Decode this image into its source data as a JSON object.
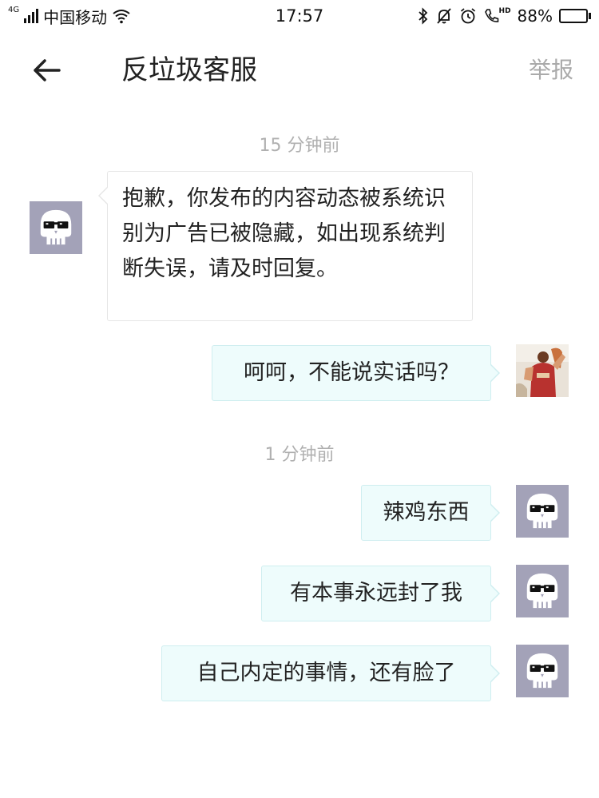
{
  "status_bar": {
    "network_type": "4G",
    "carrier": "中国移动",
    "time": "17:57",
    "hd_label": "HD",
    "battery": "88%",
    "battery_level": 0.88
  },
  "header": {
    "back_icon": "arrow-left-icon",
    "title": "反垃圾客服",
    "report_label": "举报"
  },
  "chat": {
    "messages": [
      {
        "type": "timestamp",
        "text": "15 分钟前"
      },
      {
        "type": "incoming",
        "avatar": "skull-sunglasses-icon",
        "text": "抱歉，你发布的内容动态被系统识别为广告已被隐藏，如出现系统判断失误，请及时回复。"
      },
      {
        "type": "outgoing",
        "avatar": "user-photo",
        "text": "呵呵，不能说实话吗？"
      },
      {
        "type": "timestamp",
        "text": "1 分钟前"
      },
      {
        "type": "outgoing",
        "avatar": "skull-sunglasses-icon",
        "text": "辣鸡东西"
      },
      {
        "type": "outgoing",
        "avatar": "skull-sunglasses-icon",
        "text": "有本事永远封了我"
      },
      {
        "type": "outgoing",
        "avatar": "skull-sunglasses-icon",
        "text": "自己内定的事情，还有脸了"
      }
    ]
  },
  "colors": {
    "incoming_bubble": "#ffffff",
    "outgoing_bubble": "#eefcfc",
    "avatar_bg": "#a3a2b8",
    "timestamp_text": "#b0b0b0",
    "report_text": "#aaaaaa"
  }
}
